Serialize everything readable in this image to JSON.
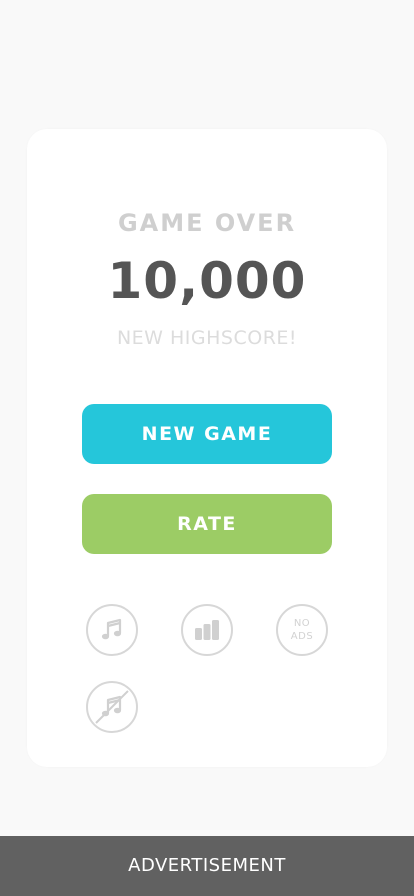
{
  "game_over": {
    "title": "GAME OVER",
    "score": "10,000",
    "subtitle": "NEW HIGHSCORE!"
  },
  "buttons": {
    "new_game": "NEW GAME",
    "rate": "RATE"
  },
  "icons": {
    "music": "music-note-icon",
    "leaderboard": "bar-chart-icon",
    "no_ads_line1": "NO",
    "no_ads_line2": "ADS",
    "music_off": "music-off-icon"
  },
  "advertisement": {
    "label": "ADVERTISEMENT"
  },
  "colors": {
    "new_game_button": "#25c6da",
    "rate_button": "#9ccc65",
    "ad_bar": "#616161"
  }
}
